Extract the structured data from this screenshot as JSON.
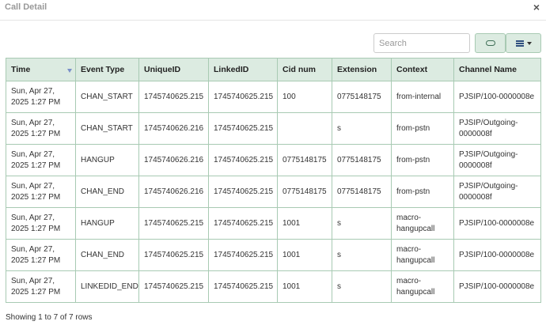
{
  "dialog": {
    "title": "Call Detail",
    "close_label": "×"
  },
  "toolbar": {
    "search_placeholder": "Search",
    "toggle_icon": "toggle-icon",
    "columns_icon": "list-icon"
  },
  "table": {
    "columns": [
      "Time",
      "Event Type",
      "UniqueID",
      "LinkedID",
      "Cid num",
      "Extension",
      "Context",
      "Channel Name"
    ],
    "sorted_column": "Time",
    "rows": [
      {
        "time_date": "Sun, Apr 27,",
        "time_clock": "2025 1:27 PM",
        "event": "CHAN_START",
        "uniqueid": "1745740625.215",
        "linkedid": "1745740625.215",
        "cid": "100",
        "ext": "0775148175",
        "context_a": "from-internal",
        "context_b": "",
        "channel_a": "PJSIP/100-0000008e",
        "channel_b": ""
      },
      {
        "time_date": "Sun, Apr 27,",
        "time_clock": "2025 1:27 PM",
        "event": "CHAN_START",
        "uniqueid": "1745740626.216",
        "linkedid": "1745740625.215",
        "cid": "",
        "ext": "s",
        "context_a": "from-pstn",
        "context_b": "",
        "channel_a": "PJSIP/Outgoing-",
        "channel_b": "0000008f"
      },
      {
        "time_date": "Sun, Apr 27,",
        "time_clock": "2025 1:27 PM",
        "event": "HANGUP",
        "uniqueid": "1745740626.216",
        "linkedid": "1745740625.215",
        "cid": "0775148175",
        "ext": "0775148175",
        "context_a": "from-pstn",
        "context_b": "",
        "channel_a": "PJSIP/Outgoing-",
        "channel_b": "0000008f"
      },
      {
        "time_date": "Sun, Apr 27,",
        "time_clock": "2025 1:27 PM",
        "event": "CHAN_END",
        "uniqueid": "1745740626.216",
        "linkedid": "1745740625.215",
        "cid": "0775148175",
        "ext": "0775148175",
        "context_a": "from-pstn",
        "context_b": "",
        "channel_a": "PJSIP/Outgoing-",
        "channel_b": "0000008f"
      },
      {
        "time_date": "Sun, Apr 27,",
        "time_clock": "2025 1:27 PM",
        "event": "HANGUP",
        "uniqueid": "1745740625.215",
        "linkedid": "1745740625.215",
        "cid": "1001",
        "ext": "s",
        "context_a": "macro-",
        "context_b": "hangupcall",
        "channel_a": "PJSIP/100-0000008e",
        "channel_b": ""
      },
      {
        "time_date": "Sun, Apr 27,",
        "time_clock": "2025 1:27 PM",
        "event": "CHAN_END",
        "uniqueid": "1745740625.215",
        "linkedid": "1745740625.215",
        "cid": "1001",
        "ext": "s",
        "context_a": "macro-",
        "context_b": "hangupcall",
        "channel_a": "PJSIP/100-0000008e",
        "channel_b": ""
      },
      {
        "time_date": "Sun, Apr 27,",
        "time_clock": "2025 1:27 PM",
        "event": "LINKEDID_END",
        "uniqueid": "1745740625.215",
        "linkedid": "1745740625.215",
        "cid": "1001",
        "ext": "s",
        "context_a": "macro-",
        "context_b": "hangupcall",
        "channel_a": "PJSIP/100-0000008e",
        "channel_b": ""
      }
    ]
  },
  "footer": {
    "pagination_text": "Showing 1 to 7 of 7 rows"
  },
  "colors": {
    "header_bg": "#dcebe1",
    "border": "#a8cab3",
    "sort_arrow": "#7a8fc9"
  }
}
